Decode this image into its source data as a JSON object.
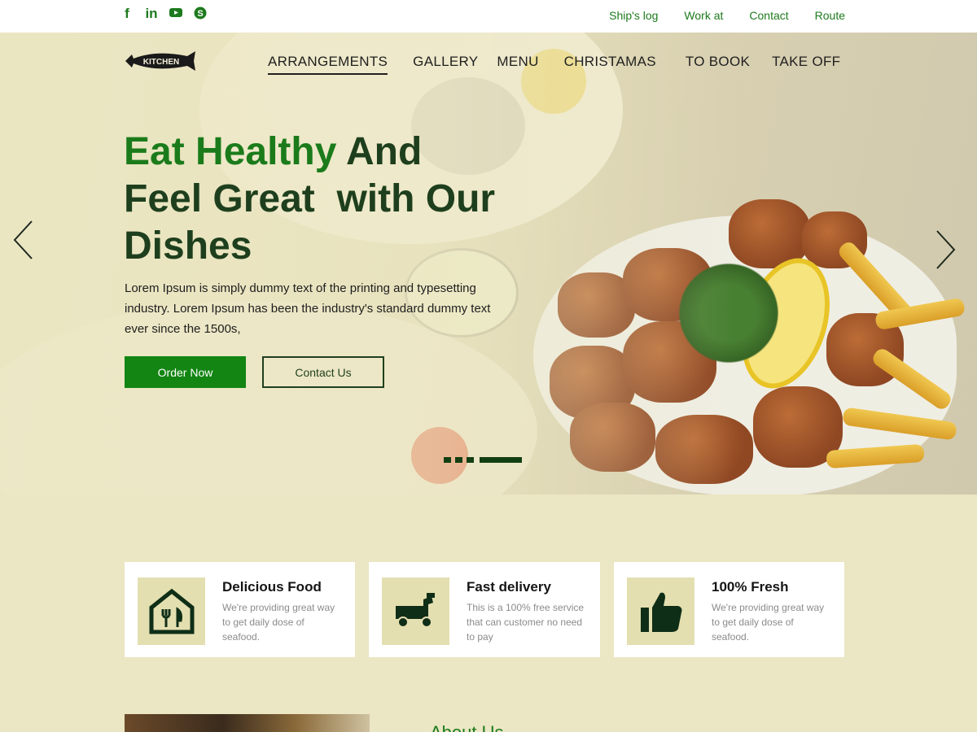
{
  "topbar": {
    "social_icons": [
      "facebook-icon",
      "linkedin-icon",
      "youtube-icon",
      "skype-icon"
    ],
    "links": [
      "Ship's log",
      "Work at",
      "Contact",
      "Route"
    ]
  },
  "nav": {
    "logo_text": "KITCHEN",
    "items": [
      "ARRANGEMENTS",
      "GALLERY",
      "MENU",
      "CHRISTAMAS",
      "TO BOOK",
      "TAKE OFF"
    ],
    "active_index": 0
  },
  "hero": {
    "headline_green": "Eat Healthy",
    "headline_rest_1": " And",
    "headline_line2": "Feel Great  with Our",
    "headline_line3": "Dishes",
    "intro": "Lorem Ipsum is simply dummy text of the printing and typesetting industry. Lorem Ipsum has been the industry's standard dummy text ever since the 1500s,",
    "order_button": "Order Now",
    "contact_button": "Contact Us",
    "slider_dots": 3
  },
  "features": [
    {
      "icon": "restaurant-house-icon",
      "title": "Delicious Food",
      "text": "We're providing great way to get daily dose of seafood."
    },
    {
      "icon": "delivery-scooter-icon",
      "title": "Fast delivery",
      "text": "This is a 100% free service that can customer no need to pay"
    },
    {
      "icon": "thumbs-up-icon",
      "title": "100% Fresh",
      "text": "We're providing great way to get daily dose of seafood."
    }
  ],
  "about": {
    "title": "About Us"
  },
  "colors": {
    "brand_green": "#128512",
    "dark_green": "#1e3f1d",
    "background": "#ebe6c3"
  }
}
